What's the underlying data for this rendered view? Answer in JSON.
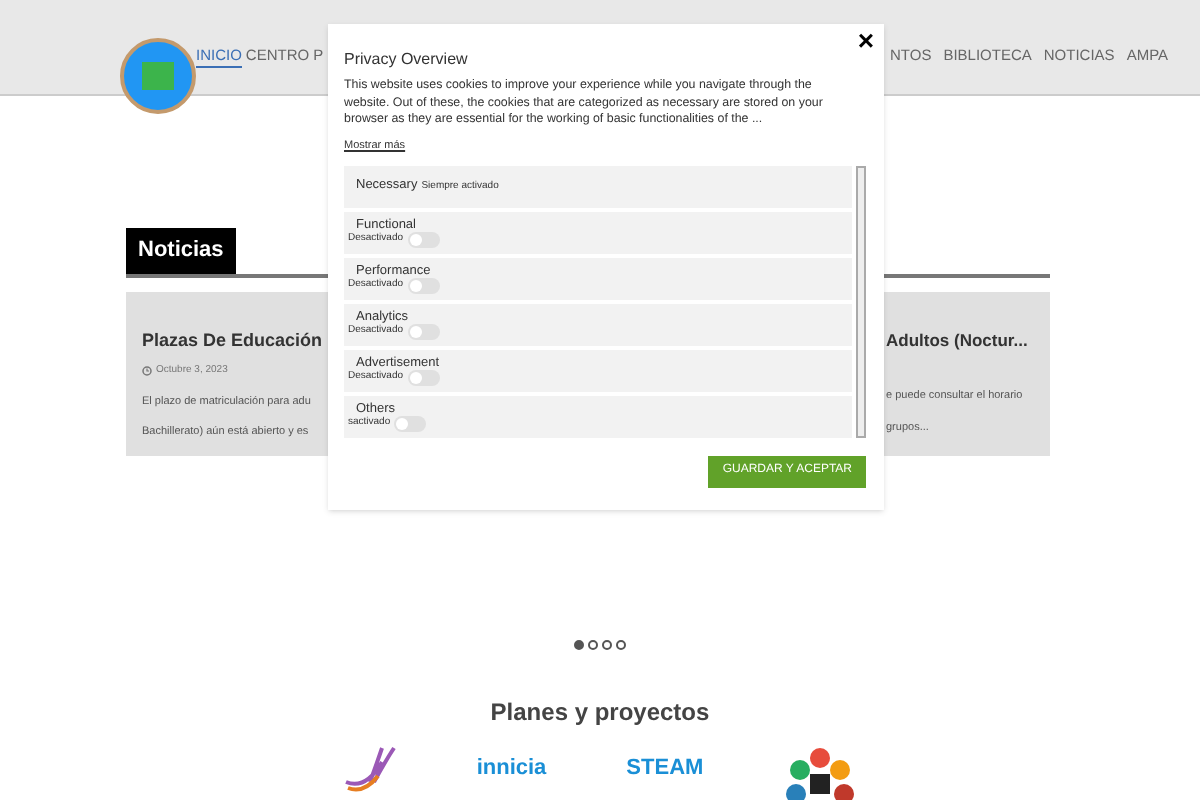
{
  "nav": {
    "items": [
      {
        "label": "INICIO",
        "selected": true
      },
      {
        "label": "CENTRO",
        "selected": false
      },
      {
        "label": "P",
        "selected": false
      }
    ],
    "items_right": [
      {
        "label": "NTOS",
        "selected": false
      },
      {
        "label": "BIBLIOTECA",
        "selected": false
      },
      {
        "label": "NOTICIAS",
        "selected": false
      },
      {
        "label": "AMPA",
        "selected": false
      }
    ]
  },
  "news": {
    "heading": "Noticias",
    "left": {
      "title": "Plazas De Educación",
      "date": "Octubre 3, 2023",
      "lines": [
        "El plazo de matriculación para adu",
        "Bachillerato) aún está abierto y es"
      ]
    },
    "right": {
      "title": "Adultos (Noctur...",
      "lines": [
        "e puede consultar el horario",
        "grupos..."
      ]
    },
    "slides": [
      {
        "selected": true
      },
      {
        "selected": false
      },
      {
        "selected": false
      },
      {
        "selected": false
      }
    ]
  },
  "projects": {
    "heading": "Planes y proyectos",
    "logos": [
      {
        "kind": "dove"
      },
      {
        "kind": "wordmark",
        "text": "innicia"
      },
      {
        "kind": "wordmark",
        "text": "STEAM"
      },
      {
        "kind": "hearts"
      }
    ]
  },
  "modal": {
    "title": "Privacy Overview",
    "body": "This website uses cookies to improve your experience while you navigate through the website. Out of these, the cookies that are categorized as necessary are stored on your browser as they are essential for the working of basic functionalities of the ...",
    "more": "Mostrar más",
    "close": "×",
    "categories": [
      {
        "kind": "always",
        "name": "Necessary",
        "status": "Siempre activado"
      },
      {
        "kind": "toggle",
        "name": "Functional",
        "status": "Desactivado",
        "checked": false
      },
      {
        "kind": "toggle",
        "name": "Performance",
        "status": "Desactivado",
        "checked": false
      },
      {
        "kind": "toggle",
        "name": "Analytics",
        "status": "Desactivado",
        "checked": false
      },
      {
        "kind": "toggle",
        "name": "Advertisement",
        "status": "Desactivado",
        "checked": false
      },
      {
        "kind": "toggle",
        "name": "Others",
        "status": "sactivado",
        "checked": false
      }
    ],
    "button": "GUARDAR Y ACEPTAR"
  }
}
